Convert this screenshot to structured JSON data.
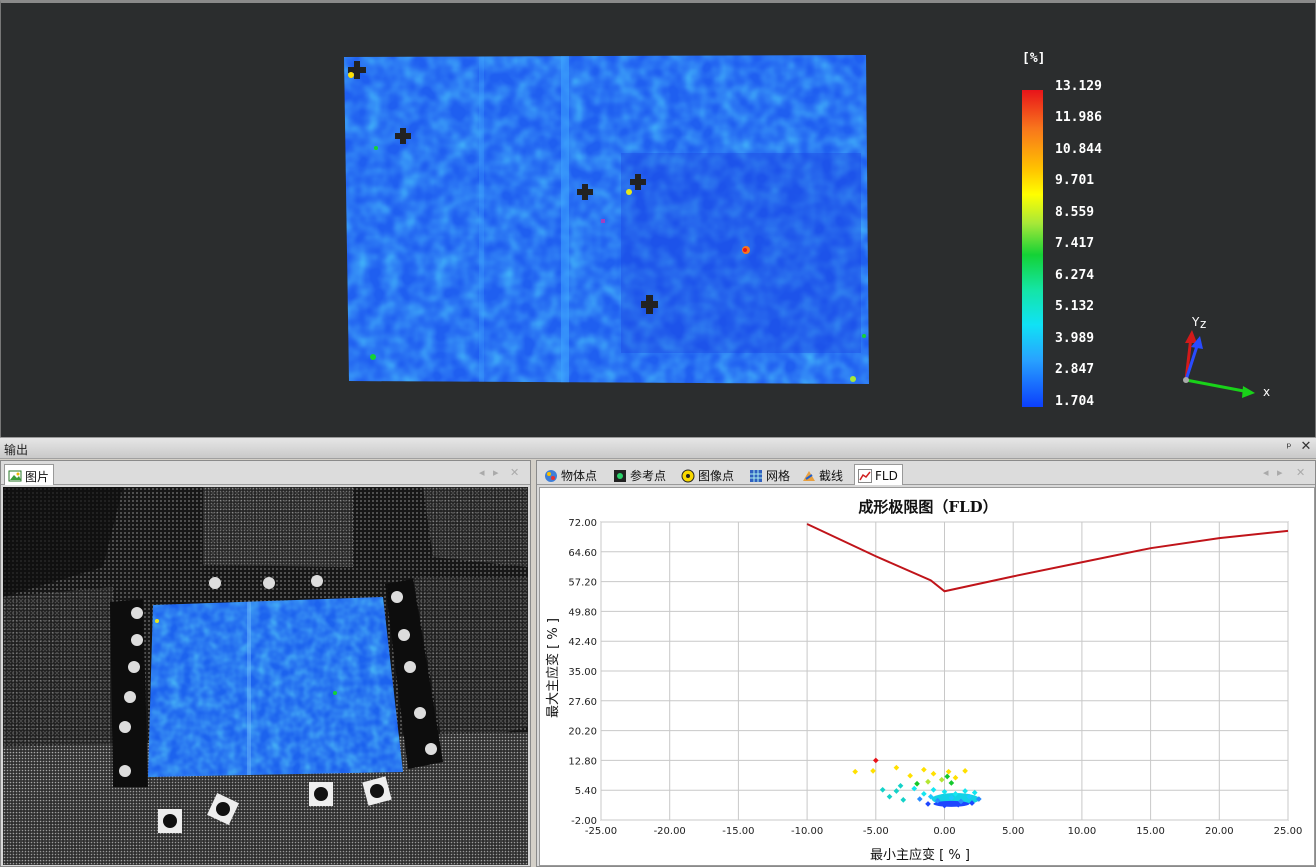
{
  "viewer": {
    "legend": {
      "unit": "[%]",
      "values": [
        "13.129",
        "11.986",
        "10.844",
        "9.701",
        "8.559",
        "7.417",
        "6.274",
        "5.132",
        "3.989",
        "2.847",
        "1.704"
      ]
    },
    "axes": {
      "y_label": "Y",
      "z_label": "z",
      "x_label": "x",
      "colors": {
        "x": "#19d219",
        "y": "#d21a1a",
        "z": "#2a4bff"
      }
    }
  },
  "output_panel": {
    "title": "输出",
    "pin": "ᵖ",
    "close": "✕"
  },
  "image_pane": {
    "tabs": [
      {
        "label": "图片",
        "icon": "picture-icon"
      }
    ]
  },
  "fld_pane": {
    "tabs": [
      {
        "label": "物体点",
        "icon": "object-point-icon"
      },
      {
        "label": "参考点",
        "icon": "reference-point-icon"
      },
      {
        "label": "图像点",
        "icon": "image-point-icon"
      },
      {
        "label": "网格",
        "icon": "grid-icon"
      },
      {
        "label": "截线",
        "icon": "section-line-icon"
      },
      {
        "label": "FLD",
        "icon": "fld-chart-icon"
      }
    ],
    "active_tab": "FLD"
  },
  "chart_data": {
    "type": "scatter",
    "title": "成形极限图（FLD）",
    "xlabel": "最小主应变 [ % ]",
    "ylabel": "最大主应变 [ % ]",
    "xlim": [
      -25,
      25
    ],
    "ylim": [
      -2,
      72
    ],
    "x_ticks": [
      "-25.00",
      "-20.00",
      "-15.00",
      "-10.00",
      "-5.00",
      "0.00",
      "5.00",
      "10.00",
      "15.00",
      "20.00",
      "25.00"
    ],
    "y_ticks": [
      "72.00",
      "64.60",
      "57.20",
      "49.80",
      "42.40",
      "35.00",
      "27.60",
      "20.20",
      "12.80",
      "5.40",
      "-2.00"
    ],
    "grid": true,
    "curve": {
      "color": "#c0141a",
      "x": [
        -10,
        -5,
        -1,
        0,
        5,
        10,
        15,
        20,
        25
      ],
      "y": [
        71.5,
        63.5,
        57.5,
        54.8,
        58.5,
        62,
        65.5,
        68,
        69.8
      ]
    },
    "scatter": [
      {
        "x": -5,
        "y": 12.8,
        "color": "#e8141a"
      },
      {
        "x": -6.5,
        "y": 10,
        "color": "#ffe000"
      },
      {
        "x": -5.2,
        "y": 10.2,
        "color": "#ffe000"
      },
      {
        "x": -3.5,
        "y": 11,
        "color": "#ffe000"
      },
      {
        "x": -2.5,
        "y": 9,
        "color": "#ffe000"
      },
      {
        "x": -1.5,
        "y": 10.5,
        "color": "#ffe000"
      },
      {
        "x": -0.8,
        "y": 9.5,
        "color": "#ffe000"
      },
      {
        "x": 0.3,
        "y": 10,
        "color": "#ffe000"
      },
      {
        "x": 1.5,
        "y": 10.2,
        "color": "#ffe000"
      },
      {
        "x": 0.8,
        "y": 8.5,
        "color": "#ffe000"
      },
      {
        "x": -1.2,
        "y": 7.5,
        "color": "#b4e632"
      },
      {
        "x": -0.2,
        "y": 8,
        "color": "#b4e632"
      },
      {
        "x": 0.2,
        "y": 8.8,
        "color": "#14c82c"
      },
      {
        "x": -2,
        "y": 7,
        "color": "#14c82c"
      },
      {
        "x": 0.5,
        "y": 7.2,
        "color": "#14c82c"
      },
      {
        "x": -4.5,
        "y": 5.5,
        "color": "#14d2c8"
      },
      {
        "x": -3.5,
        "y": 5.2,
        "color": "#14d2c8"
      },
      {
        "x": -3,
        "y": 3,
        "color": "#14d2c8"
      },
      {
        "x": -4,
        "y": 3.8,
        "color": "#14d2c8"
      },
      {
        "x": -3.2,
        "y": 6.5,
        "color": "#14d2c8"
      },
      {
        "x": -2.2,
        "y": 5.8,
        "color": "#14e6f0"
      },
      {
        "x": -1.5,
        "y": 4.5,
        "color": "#14e6f0"
      },
      {
        "x": -0.8,
        "y": 5.5,
        "color": "#14e6f0"
      },
      {
        "x": 0,
        "y": 5,
        "color": "#14e6f0"
      },
      {
        "x": 0.8,
        "y": 4.5,
        "color": "#14e6f0"
      },
      {
        "x": 1.5,
        "y": 5.2,
        "color": "#14e6f0"
      },
      {
        "x": 2.2,
        "y": 4.8,
        "color": "#14e6f0"
      },
      {
        "x": -1,
        "y": 3.8,
        "color": "#1ec8ff"
      },
      {
        "x": 0.5,
        "y": 3.5,
        "color": "#1ec8ff"
      },
      {
        "x": 1.8,
        "y": 3.8,
        "color": "#1ec8ff"
      },
      {
        "x": -0.5,
        "y": 2.8,
        "color": "#2a8cff"
      },
      {
        "x": 1.2,
        "y": 2.6,
        "color": "#2a8cff"
      },
      {
        "x": 2.5,
        "y": 3.2,
        "color": "#2a8cff"
      },
      {
        "x": -1.8,
        "y": 3.2,
        "color": "#2a8cff"
      },
      {
        "x": 0,
        "y": 1.6,
        "color": "#1e46ff"
      },
      {
        "x": -1.2,
        "y": 2,
        "color": "#1e46ff"
      },
      {
        "x": 1,
        "y": 1.8,
        "color": "#1e46ff"
      },
      {
        "x": 2,
        "y": 2.2,
        "color": "#1e46ff"
      }
    ]
  }
}
